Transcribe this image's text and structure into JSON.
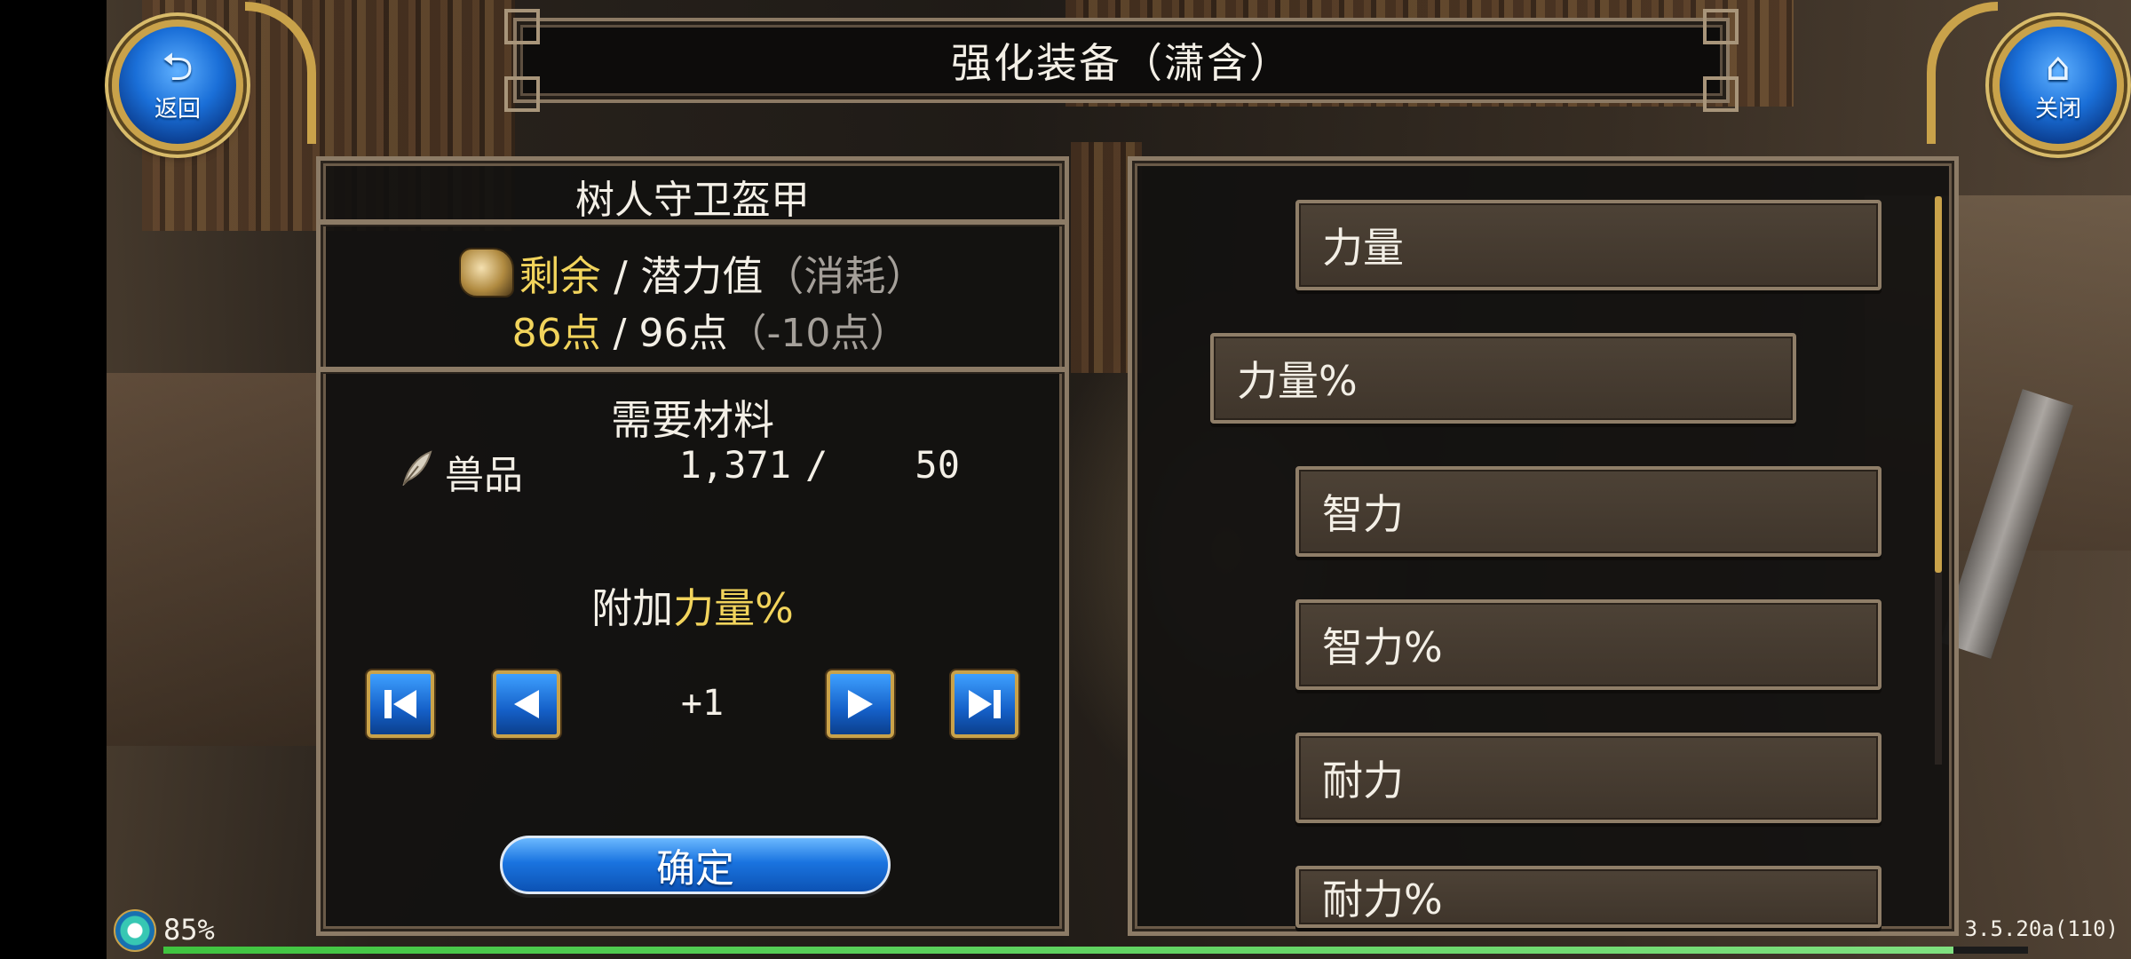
{
  "header": {
    "title": "强化装备（潇含）",
    "back_label": "返回",
    "back_icon": "back-arrow-icon",
    "close_label": "关闭",
    "close_icon": "home-icon"
  },
  "item": {
    "name": "树人守卫盔甲",
    "remaining_label": "剩余",
    "separator": " / ",
    "potential_label": "潜力值",
    "consume_label": "（消耗）",
    "remaining_value": "86点",
    "potential_value": "96点",
    "consume_value": "（-10点）"
  },
  "materials": {
    "header": "需要材料",
    "items": [
      {
        "name": "兽品",
        "owned": "1,371",
        "slash": "/",
        "required": "50",
        "icon": "feather-icon"
      }
    ]
  },
  "enhance": {
    "add_prefix": "附加",
    "stat": "力量%",
    "step": "+1",
    "buttons": [
      "first-icon",
      "prev-icon",
      "next-icon",
      "last-icon"
    ],
    "confirm_label": "确定"
  },
  "stat_options": [
    {
      "label": "力量",
      "selected": false
    },
    {
      "label": "力量%",
      "selected": true
    },
    {
      "label": "智力",
      "selected": false
    },
    {
      "label": "智力%",
      "selected": false
    },
    {
      "label": "耐力",
      "selected": false
    },
    {
      "label": "耐力%",
      "selected": false
    }
  ],
  "status": {
    "battery": "85%",
    "version": "3.5.20a(110)",
    "progress": 0.96
  },
  "colors": {
    "highlight": "#f2d45c",
    "muted": "#a5a09a",
    "frame": "#8c7b66",
    "button_blue": "#1a74e0",
    "gold": "#c9a24a"
  }
}
